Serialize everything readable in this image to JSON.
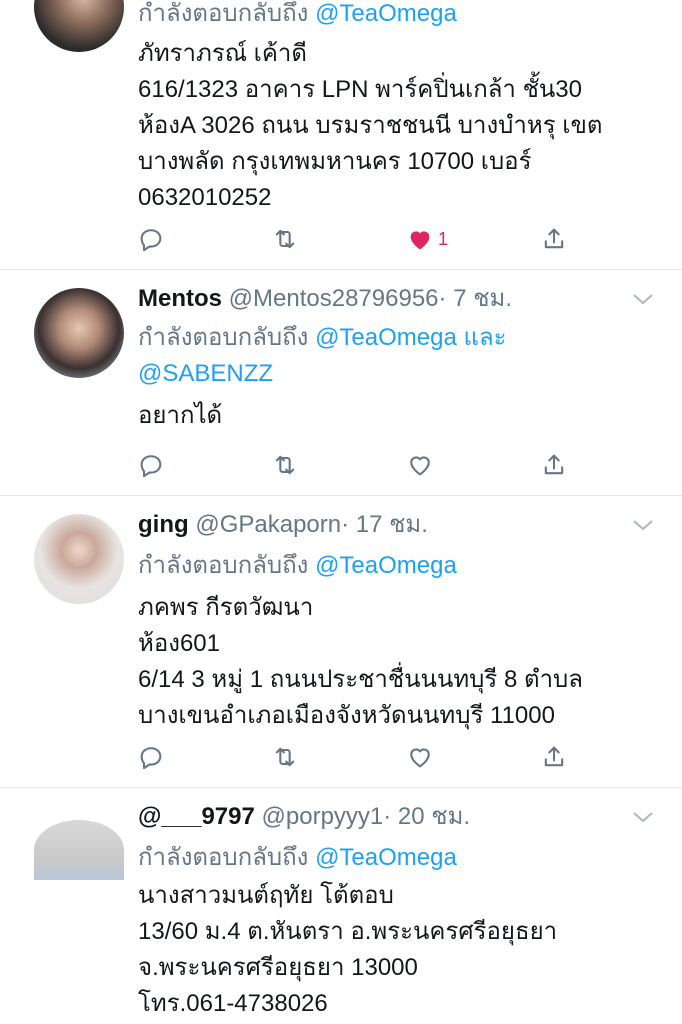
{
  "tweets": [
    {
      "name": "",
      "handle": "",
      "time": "",
      "reply_prefix": "กำลังตอบกลับถึง",
      "mention1": "@TeaOmega",
      "mention_and": "",
      "mention2": "",
      "lines": [
        "ภัทราภรณ์ เค้าดี",
        "616/1323 อาคาร LPN พาร์คปิ่นเกล้า ชั้น30",
        "ห้องA 3026 ถนน บรมราชชนนี บางบำหรุ เขต",
        "บางพลัด กรุงเทพมหานคร 10700 เบอร์",
        "0632010252"
      ],
      "like_count": "1",
      "liked": true
    },
    {
      "name": "Mentos",
      "handle": "@Mentos28796956",
      "time": "· 7 ชม.",
      "reply_prefix": "กำลังตอบกลับถึง",
      "mention1": "@TeaOmega",
      "mention_and": "และ",
      "mention2": "@SABENZZ",
      "lines": [
        "อยากได้"
      ],
      "like_count": "",
      "liked": false
    },
    {
      "name": "ging",
      "handle": "@GPakaporn",
      "time": "· 17 ชม.",
      "reply_prefix": "กำลังตอบกลับถึง",
      "mention1": "@TeaOmega",
      "mention_and": "",
      "mention2": "",
      "lines": [
        "ภคพร กีรตวัฒนา",
        "ห้อง601",
        "6/14 3 หมู่ 1  ถนนประชาชื่นนนทบุรี 8 ตำบล",
        "บางเขนอำเภอเมืองจังหวัดนนทบุรี  11000"
      ],
      "like_count": "",
      "liked": false
    },
    {
      "name": "@___9797",
      "handle": "@porpyyy1",
      "time": "· 20 ชม.",
      "reply_prefix": "กำลังตอบกลับถึง",
      "mention1": "@TeaOmega",
      "mention_and": "",
      "mention2": "",
      "lines": [
        "นางสาวมนต์ฤทัย โต้ตอบ",
        "13/60 ม.4 ต.หันตรา อ.พระนครศรีอยุธยา",
        "จ.พระนครศรีอยุธยา 13000",
        "โทร.061-4738026"
      ],
      "like_count": "",
      "liked": false
    }
  ],
  "icons": {
    "reply": "reply-icon",
    "retweet": "retweet-icon",
    "like": "heart-icon",
    "share": "share-icon",
    "more": "chevron-down-icon"
  },
  "colors": {
    "mention": "#1da1f2",
    "secondary": "#657786",
    "like_active": "#e0245e",
    "divider": "#e1e8ed"
  }
}
